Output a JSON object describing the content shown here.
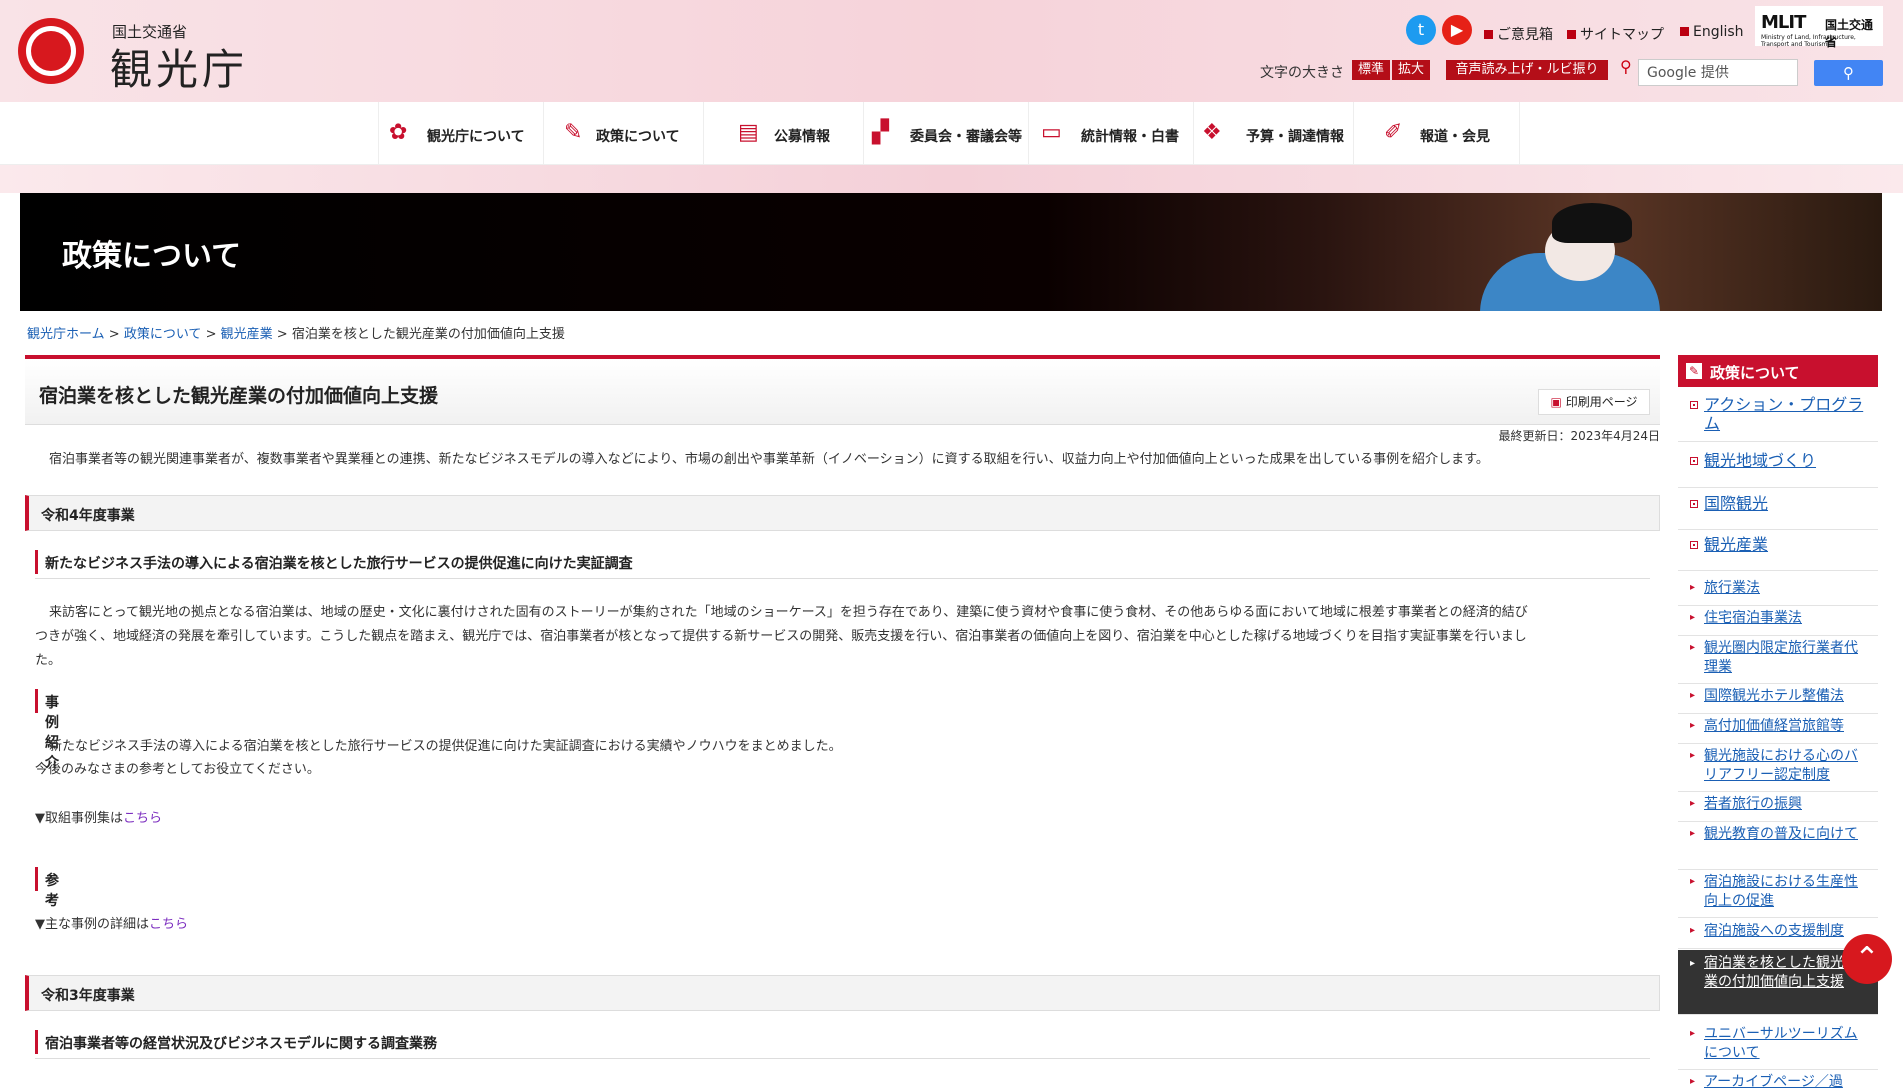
{
  "header": {
    "ministry": "国土交通省",
    "agency": "観光庁",
    "links": [
      {
        "label": "ご意見箱"
      },
      {
        "label": "サイトマップ"
      },
      {
        "label": "English"
      }
    ],
    "mlit": {
      "logo": "MLIT",
      "jp": "国土交通省",
      "sub": "Ministry of Land, Infrastructure, Transport and Tourism"
    },
    "font_size_label": "文字の大きさ",
    "font_std": "標準",
    "font_big": "拡大",
    "read_aloud": "音声読み上げ・ルビ振り",
    "search_placeholder": "Google 提供",
    "colors": {
      "accent": "#c8102e",
      "search_button": "#4285f4"
    }
  },
  "nav": {
    "items": [
      {
        "label": "観光庁について",
        "icon": "flower-icon"
      },
      {
        "label": "政策について",
        "icon": "pen-icon"
      },
      {
        "label": "公募情報",
        "icon": "clipboard-icon"
      },
      {
        "label": "委員会・審議会等",
        "icon": "people-icon"
      },
      {
        "label": "統計情報・白書",
        "icon": "chart-icon"
      },
      {
        "label": "予算・調達情報",
        "icon": "handshake-icon"
      },
      {
        "label": "報道・会見",
        "icon": "microphone-icon"
      }
    ]
  },
  "hero": {
    "title": "政策について"
  },
  "breadcrumb": {
    "items": [
      "観光庁ホーム",
      "政策について",
      "観光産業"
    ],
    "current": "宿泊業を核とした観光産業の付加価値向上支援",
    "sep": ">"
  },
  "main": {
    "title": "宿泊業を核とした観光産業の付加価値向上支援",
    "print_label": "印刷用ページ",
    "updated": "最終更新日：2023年4月24日",
    "intro": "宿泊事業者等の観光関連事業者が、複数事業者や異業種との連携、新たなビジネスモデルの導入などにより、市場の創出や事業革新（イノベーション）に資する取組を行い、収益力向上や付加価値向上といった成果を出している事例を紹介します。",
    "r4": {
      "heading": "令和4年度事業",
      "sub": "新たなビジネス手法の導入による宿泊業を核とした旅行サービスの提供促進に向けた実証調査",
      "body1": "来訪客にとって観光地の拠点となる宿泊業は、地域の歴史・文化に裏付けされた固有のストーリーが集約された「地域のショーケース」を担う存在であり、建築に使う資材や食事に使う食材、その他あらゆる面において地域に根差す事業者との経済的結び",
      "body2": "つきが強く、地域経済の発展を牽引しています。こうした観点を踏まえ、観光庁では、宿泊事業者が核となって提供する新サービスの開発、販売支援を行い、宿泊事業者の価値向上を図り、宿泊業を中心とした稼げる地域づくりを目指す実証事業を行いまし",
      "body3": "た。",
      "case_heading": "事例紹介",
      "case_text1": "新たなビジネス手法の導入による宿泊業を核とした旅行サービスの提供促進に向けた実証調査における実績やノウハウをまとめました。",
      "case_text2": "今後のみなさまの参考としてお役立てください。",
      "case_link_prefix": "▼取組事例集は",
      "case_link": "こちら",
      "ref_heading": "参考",
      "ref_link_prefix": "▼主な事例の詳細は",
      "ref_link": "こちら"
    },
    "r3": {
      "heading": "令和3年度事業",
      "sub": "宿泊事業者等の経営状況及びビジネスモデルに関する調査業務"
    }
  },
  "sidebar": {
    "heading": "政策について",
    "items": [
      {
        "label": "アクション・プログラム"
      },
      {
        "label": "観光地域づくり"
      },
      {
        "label": "国際観光"
      },
      {
        "label": "観光産業"
      }
    ],
    "subitems": [
      {
        "label": "旅行業法"
      },
      {
        "label": "住宅宿泊事業法"
      },
      {
        "label": "観光圏内限定旅行業者代理業"
      },
      {
        "label": "国際観光ホテル整備法"
      },
      {
        "label": "高付加価値経営旅館等"
      },
      {
        "label": "観光施設における心のバリアフリー認定制度"
      },
      {
        "label": "若者旅行の振興"
      },
      {
        "label": "観光教育の普及に向けて"
      },
      {
        "label": "宿泊施設における生産性向上の促進"
      },
      {
        "label": "宿泊施設への支援制度"
      },
      {
        "label": "宿泊業を核とした観光産業の付加価値向上支援"
      },
      {
        "label": "ユニバーサルツーリズムについて"
      },
      {
        "label": "アーカイブページ／過"
      }
    ]
  }
}
